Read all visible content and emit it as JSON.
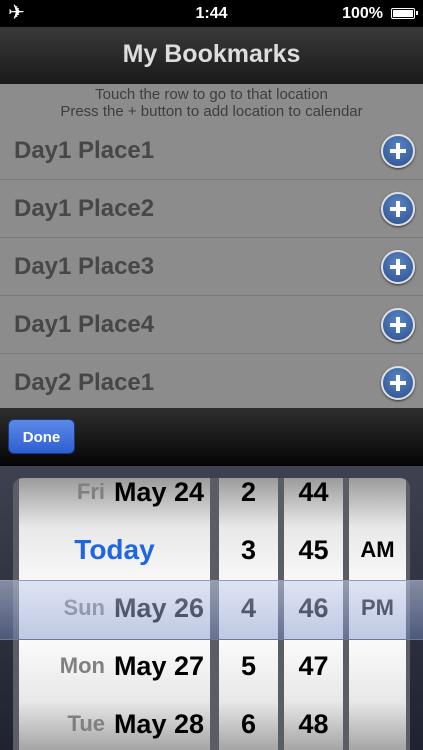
{
  "status": {
    "airplane_icon": "airplane-icon",
    "time": "1:44",
    "battery": "100%"
  },
  "nav": {
    "title": "My Bookmarks"
  },
  "hint": {
    "line1": "Touch the row to go to that location",
    "line2": "Press the + button to add location to calendar"
  },
  "bookmarks": [
    {
      "label": "Day1 Place1"
    },
    {
      "label": "Day1 Place2"
    },
    {
      "label": "Day1 Place3"
    },
    {
      "label": "Day1 Place4"
    },
    {
      "label": "Day2 Place1"
    }
  ],
  "toolbar": {
    "done_label": "Done"
  },
  "picker": {
    "dates": [
      {
        "dow": "Fri",
        "date": "May 24"
      },
      {
        "label": "Today"
      },
      {
        "dow": "Sun",
        "date": "May 26"
      },
      {
        "dow": "Mon",
        "date": "May 27"
      },
      {
        "dow": "Tue",
        "date": "May 28"
      }
    ],
    "hours": [
      "2",
      "3",
      "4",
      "5",
      "6"
    ],
    "minutes": [
      "44",
      "45",
      "46",
      "47",
      "48"
    ],
    "ampm": [
      "AM",
      "PM"
    ],
    "selected": {
      "date": "May 26",
      "hour": "4",
      "minute": "46",
      "ampm": "PM"
    }
  }
}
